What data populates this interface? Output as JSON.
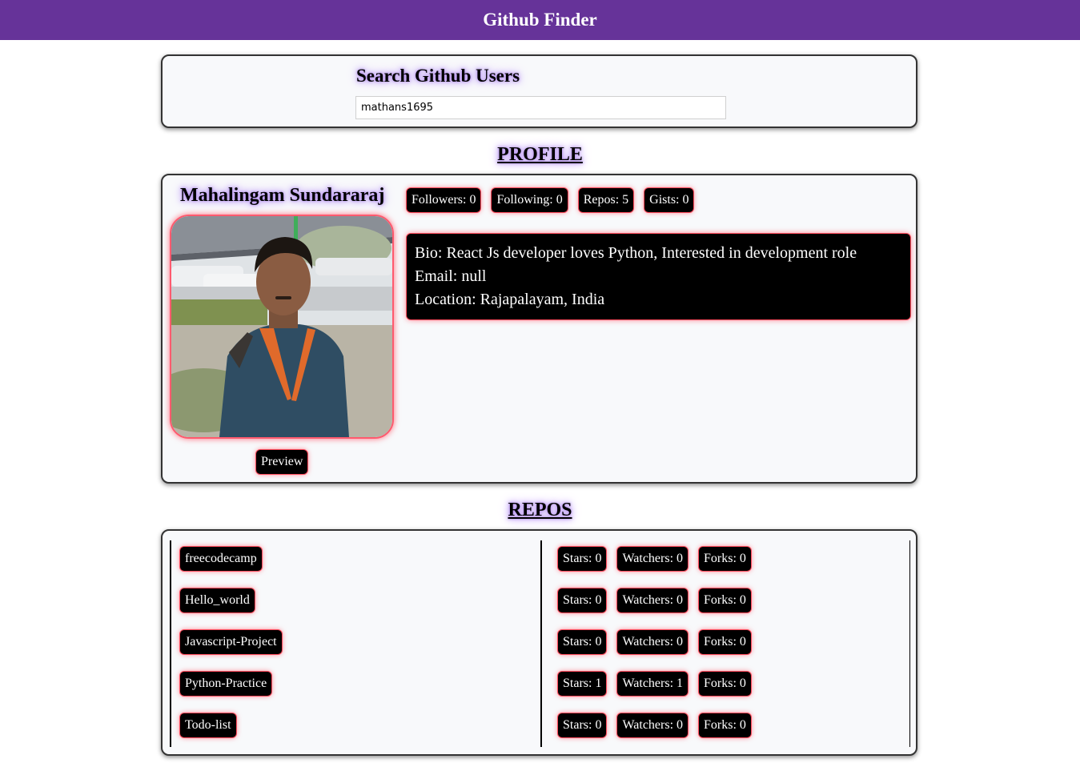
{
  "app": {
    "title": "Github Finder"
  },
  "colors": {
    "navbar": "#663399",
    "glow": "#b38cf0",
    "pill_border": "#ff4d5e"
  },
  "search": {
    "title": "Search Github Users",
    "value": "mathans1695"
  },
  "profile": {
    "heading": "PROFILE",
    "name": "Mahalingam Sundararaj",
    "avatar_icon": "user-photo",
    "preview_label": "Preview",
    "stats": [
      {
        "label": "Followers: 0"
      },
      {
        "label": "Following: 0"
      },
      {
        "label": "Repos: 5"
      },
      {
        "label": "Gists: 0"
      }
    ],
    "bio": "Bio: React Js developer loves Python, Interested in development role",
    "email": "Email: null",
    "location": "Location: Rajapalayam, India"
  },
  "repos": {
    "heading": "REPOS",
    "items": [
      {
        "name": "freecodecamp",
        "stars": "Stars: 0",
        "watchers": "Watchers: 0",
        "forks": "Forks: 0"
      },
      {
        "name": "Hello_world",
        "stars": "Stars: 0",
        "watchers": "Watchers: 0",
        "forks": "Forks: 0"
      },
      {
        "name": "Javascript-Project",
        "stars": "Stars: 0",
        "watchers": "Watchers: 0",
        "forks": "Forks: 0"
      },
      {
        "name": "Python-Practice",
        "stars": "Stars: 1",
        "watchers": "Watchers: 1",
        "forks": "Forks: 0"
      },
      {
        "name": "Todo-list",
        "stars": "Stars: 0",
        "watchers": "Watchers: 0",
        "forks": "Forks: 0"
      }
    ]
  }
}
